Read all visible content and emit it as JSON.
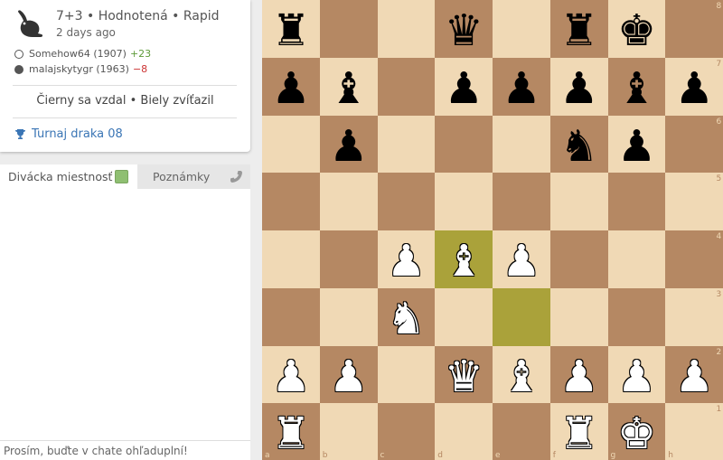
{
  "game": {
    "title": "7+3 • Hodnotená • Rapid",
    "time_ago": "2 days ago",
    "white_player": "Somehow64 (1907)",
    "white_diff": "+23",
    "black_player": "malajskytygr (1963)",
    "black_diff": "−8",
    "result": "Čierny sa vzdal • Biely zvíťazil",
    "tournament": "Turnaj draka 08"
  },
  "chat": {
    "tab_room": "Divácka miestnosť",
    "tab_notes": "Poznámky",
    "input_placeholder": "Prosím, buďte v chate ohľaduplní!"
  },
  "colors": {
    "light_square": "#f0d9b5",
    "dark_square": "#b58863",
    "highlight_light": "#cdd26a",
    "highlight_dark": "#aaa23a"
  },
  "board": {
    "files": [
      "a",
      "b",
      "c",
      "d",
      "e",
      "f",
      "g",
      "h"
    ],
    "ranks": [
      "8",
      "7",
      "6",
      "5",
      "4",
      "3",
      "2",
      "1"
    ],
    "highlight": [
      "d4",
      "e3"
    ],
    "pieces": [
      {
        "sq": "a8",
        "p": "r"
      },
      {
        "sq": "d8",
        "p": "q"
      },
      {
        "sq": "f8",
        "p": "r"
      },
      {
        "sq": "g8",
        "p": "k"
      },
      {
        "sq": "a7",
        "p": "p"
      },
      {
        "sq": "b7",
        "p": "b"
      },
      {
        "sq": "d7",
        "p": "p"
      },
      {
        "sq": "e7",
        "p": "p"
      },
      {
        "sq": "f7",
        "p": "p"
      },
      {
        "sq": "g7",
        "p": "b"
      },
      {
        "sq": "h7",
        "p": "p"
      },
      {
        "sq": "b6",
        "p": "p"
      },
      {
        "sq": "f6",
        "p": "n"
      },
      {
        "sq": "g6",
        "p": "p"
      },
      {
        "sq": "c4",
        "p": "P"
      },
      {
        "sq": "d4",
        "p": "B"
      },
      {
        "sq": "e4",
        "p": "P"
      },
      {
        "sq": "c3",
        "p": "N"
      },
      {
        "sq": "a2",
        "p": "P"
      },
      {
        "sq": "b2",
        "p": "P"
      },
      {
        "sq": "d2",
        "p": "Q"
      },
      {
        "sq": "e2",
        "p": "B"
      },
      {
        "sq": "f2",
        "p": "P"
      },
      {
        "sq": "g2",
        "p": "P"
      },
      {
        "sq": "h2",
        "p": "P"
      },
      {
        "sq": "a1",
        "p": "R"
      },
      {
        "sq": "f1",
        "p": "R"
      },
      {
        "sq": "g1",
        "p": "K"
      }
    ]
  }
}
